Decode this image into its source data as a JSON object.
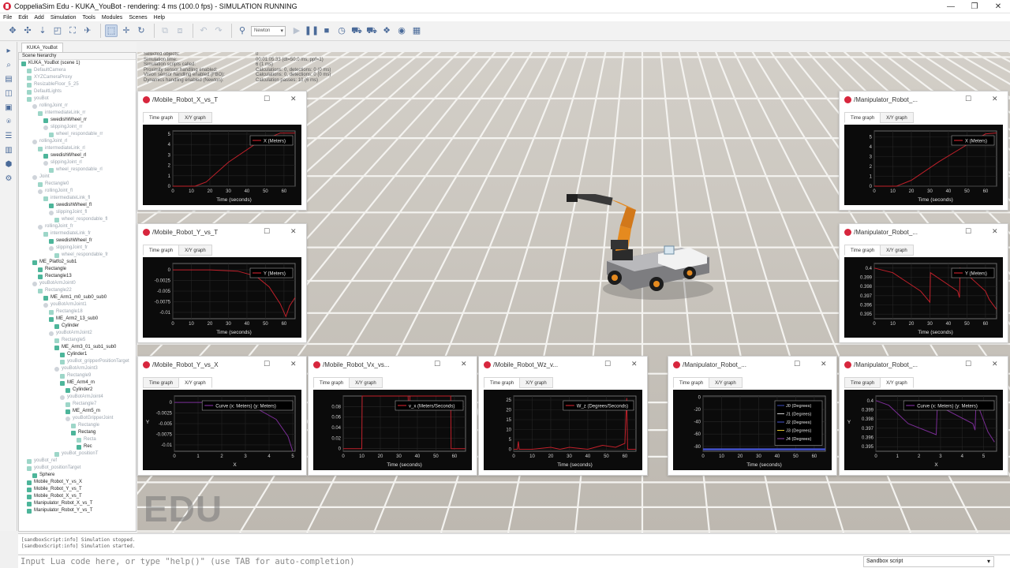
{
  "window": {
    "title": "CoppeliaSim Edu - KUKA_YouBot - rendering: 4 ms (100.0 fps) - SIMULATION RUNNING"
  },
  "menu": [
    "File",
    "Edit",
    "Add",
    "Simulation",
    "Tools",
    "Modules",
    "Scenes",
    "Help"
  ],
  "toolbar": {
    "engine": "Newton"
  },
  "scene": {
    "tab": "KUKA_YouBot",
    "header": "Scene hierarchy",
    "items": [
      {
        "label": "KUKA_YouBot (scene 1)",
        "indent": 0,
        "dim": false,
        "kind": "scene"
      },
      {
        "label": "DefaultCamera",
        "indent": 1,
        "dim": true,
        "kind": "obj"
      },
      {
        "label": "XYZCameraProxy",
        "indent": 1,
        "dim": true,
        "kind": "obj"
      },
      {
        "label": "ResizableFloor_5_25",
        "indent": 1,
        "dim": true,
        "kind": "obj"
      },
      {
        "label": "DefaultLights",
        "indent": 1,
        "dim": true,
        "kind": "obj"
      },
      {
        "label": "youBot",
        "indent": 1,
        "dim": true,
        "kind": "obj"
      },
      {
        "label": "rollingJoint_rr",
        "indent": 2,
        "dim": true,
        "kind": "joint"
      },
      {
        "label": "intermediateLink_rr",
        "indent": 3,
        "dim": true,
        "kind": "obj"
      },
      {
        "label": "swedishWheel_rr",
        "indent": 4,
        "dim": false,
        "kind": "obj"
      },
      {
        "label": "slippingJoint_rr",
        "indent": 4,
        "dim": true,
        "kind": "joint"
      },
      {
        "label": "wheel_respondable_rr",
        "indent": 5,
        "dim": true,
        "kind": "obj"
      },
      {
        "label": "rollingJoint_rl",
        "indent": 2,
        "dim": true,
        "kind": "joint"
      },
      {
        "label": "intermediateLink_rl",
        "indent": 3,
        "dim": true,
        "kind": "obj"
      },
      {
        "label": "swedishWheel_rl",
        "indent": 4,
        "dim": false,
        "kind": "obj"
      },
      {
        "label": "slippingJoint_rl",
        "indent": 4,
        "dim": true,
        "kind": "joint"
      },
      {
        "label": "wheel_respondable_rl",
        "indent": 5,
        "dim": true,
        "kind": "obj"
      },
      {
        "label": "Joint",
        "indent": 2,
        "dim": true,
        "kind": "joint"
      },
      {
        "label": "Rectangle0",
        "indent": 3,
        "dim": true,
        "kind": "obj"
      },
      {
        "label": "rollingJoint_fl",
        "indent": 3,
        "dim": true,
        "kind": "joint"
      },
      {
        "label": "intermediateLink_fl",
        "indent": 4,
        "dim": true,
        "kind": "obj"
      },
      {
        "label": "swedishWheel_fl",
        "indent": 5,
        "dim": false,
        "kind": "obj"
      },
      {
        "label": "slippingJoint_fl",
        "indent": 5,
        "dim": true,
        "kind": "joint"
      },
      {
        "label": "wheel_respondable_fl",
        "indent": 6,
        "dim": true,
        "kind": "obj"
      },
      {
        "label": "rollingJoint_fr",
        "indent": 3,
        "dim": true,
        "kind": "joint"
      },
      {
        "label": "intermediateLink_fr",
        "indent": 4,
        "dim": true,
        "kind": "obj"
      },
      {
        "label": "swedishWheel_fr",
        "indent": 5,
        "dim": false,
        "kind": "obj"
      },
      {
        "label": "slippingJoint_fr",
        "indent": 5,
        "dim": true,
        "kind": "joint"
      },
      {
        "label": "wheel_respondable_fr",
        "indent": 6,
        "dim": true,
        "kind": "obj"
      },
      {
        "label": "ME_Platfo2_sub1",
        "indent": 2,
        "dim": false,
        "kind": "obj"
      },
      {
        "label": "Rectangle",
        "indent": 3,
        "dim": false,
        "kind": "obj"
      },
      {
        "label": "Rectangle13",
        "indent": 3,
        "dim": false,
        "kind": "obj"
      },
      {
        "label": "youBotArmJoint0",
        "indent": 2,
        "dim": true,
        "kind": "joint"
      },
      {
        "label": "Rectangle22",
        "indent": 3,
        "dim": true,
        "kind": "obj"
      },
      {
        "label": "ME_Arm1_m0_sub0_sub0",
        "indent": 4,
        "dim": false,
        "kind": "obj"
      },
      {
        "label": "youBotArmJoint1",
        "indent": 4,
        "dim": true,
        "kind": "joint"
      },
      {
        "label": "Rectangle18",
        "indent": 5,
        "dim": true,
        "kind": "obj"
      },
      {
        "label": "ME_Arm2_13_sub0",
        "indent": 5,
        "dim": false,
        "kind": "obj"
      },
      {
        "label": "Cylinder",
        "indent": 6,
        "dim": false,
        "kind": "obj"
      },
      {
        "label": "youBotArmJoint2",
        "indent": 5,
        "dim": true,
        "kind": "joint"
      },
      {
        "label": "Rectangle5",
        "indent": 6,
        "dim": true,
        "kind": "obj"
      },
      {
        "label": "ME_Arm3_01_sub1_sub0",
        "indent": 6,
        "dim": false,
        "kind": "obj"
      },
      {
        "label": "Cylinder1",
        "indent": 7,
        "dim": false,
        "kind": "obj"
      },
      {
        "label": "youBot_gripperPositionTarget",
        "indent": 7,
        "dim": true,
        "kind": "obj"
      },
      {
        "label": "youBotArmJoint3",
        "indent": 6,
        "dim": true,
        "kind": "joint"
      },
      {
        "label": "Rectangle9",
        "indent": 7,
        "dim": true,
        "kind": "obj"
      },
      {
        "label": "ME_Arm4_m",
        "indent": 7,
        "dim": false,
        "kind": "obj"
      },
      {
        "label": "Cylinder2",
        "indent": 8,
        "dim": false,
        "kind": "obj"
      },
      {
        "label": "youBotArmJoint4",
        "indent": 7,
        "dim": true,
        "kind": "joint"
      },
      {
        "label": "Rectangle7",
        "indent": 8,
        "dim": true,
        "kind": "obj"
      },
      {
        "label": "ME_Arm5_m",
        "indent": 8,
        "dim": false,
        "kind": "obj"
      },
      {
        "label": "youBotGripperJoint",
        "indent": 8,
        "dim": true,
        "kind": "joint"
      },
      {
        "label": "Rectangle",
        "indent": 9,
        "dim": true,
        "kind": "obj"
      },
      {
        "label": "Rectang",
        "indent": 9,
        "dim": false,
        "kind": "obj"
      },
      {
        "label": "Recta",
        "indent": 10,
        "dim": true,
        "kind": "obj"
      },
      {
        "label": "Rec",
        "indent": 10,
        "dim": false,
        "kind": "obj"
      },
      {
        "label": "youBot_positionT",
        "indent": 6,
        "dim": true,
        "kind": "obj"
      },
      {
        "label": "youBot_ref",
        "indent": 1,
        "dim": true,
        "kind": "obj"
      },
      {
        "label": "youBot_positionTarget",
        "indent": 1,
        "dim": true,
        "kind": "obj"
      },
      {
        "label": "Sphere",
        "indent": 2,
        "dim": false,
        "kind": "obj"
      },
      {
        "label": "Mobile_Robot_Y_vs_X",
        "indent": 1,
        "dim": false,
        "kind": "graph"
      },
      {
        "label": "Mobile_Robot_Y_vs_T",
        "indent": 1,
        "dim": false,
        "kind": "graph"
      },
      {
        "label": "Mobile_Robot_X_vs_T",
        "indent": 1,
        "dim": false,
        "kind": "graph"
      },
      {
        "label": "Manipulator_Robot_X_vs_T",
        "indent": 1,
        "dim": false,
        "kind": "graph"
      },
      {
        "label": "Manipulator_Robot_Y_vs_T",
        "indent": 1,
        "dim": false,
        "kind": "graph"
      }
    ]
  },
  "sim_info": [
    {
      "k": "Selected objects:",
      "v": "0"
    },
    {
      "k": "Simulation time:",
      "v": "00:01:05.33 (dt=50.0 ms, ppf=1)"
    },
    {
      "k": "Simulation scripts called:",
      "v": "6 (1 ms)"
    },
    {
      "k": "Proximity sensor handling enabled:",
      "v": "Calculations: 0, detections: 0 (0 ms)"
    },
    {
      "k": "Vision sensor handling enabled (FBO):",
      "v": "Calculations: 0, detections: 0 (0 ms)"
    },
    {
      "k": "Dynamics handling enabled (Newton):",
      "v": "Calculation passes: 10 (6 ms)"
    }
  ],
  "watermark": "EDU",
  "graphs": {
    "w1": {
      "title": "/Mobile_Robot_X_vs_T",
      "tab1": "Time graph",
      "tab2": "X/Y graph",
      "active": 1,
      "legend": "X (Meters)",
      "xlabel": "Time (seconds)",
      "ylabel": "",
      "xticks": [
        "0",
        "10",
        "20",
        "30",
        "40",
        "50",
        "60"
      ],
      "yticks": [
        "0",
        "1",
        "2",
        "3",
        "4",
        "5"
      ]
    },
    "w2": {
      "title": "/Mobile_Robot_Y_vs_T",
      "tab1": "Time graph",
      "tab2": "X/Y graph",
      "active": 1,
      "legend": "Y (Meters)",
      "xlabel": "Time (seconds)",
      "ylabel": "",
      "xticks": [
        "0",
        "10",
        "20",
        "30",
        "40",
        "50",
        "60"
      ],
      "yticks": [
        "0",
        "-0.0025",
        "-0.005",
        "-0.0075",
        "-0.01"
      ]
    },
    "w3": {
      "title": "/Mobile_Robot_Y_vs_X",
      "tab1": "Time graph",
      "tab2": "X/Y graph",
      "active": 2,
      "legend": "Curve (x: Meters) (y: Meters)",
      "xlabel": "X",
      "ylabel": "Y",
      "xticks": [
        "0",
        "1",
        "2",
        "3",
        "4",
        "5"
      ],
      "yticks": [
        "0",
        "-0.0025",
        "-0.005",
        "-0.0075",
        "-0.01"
      ]
    },
    "w4": {
      "title": "/Mobile_Robot_Vx_vs...",
      "tab1": "Time graph",
      "tab2": "X/Y graph",
      "active": 1,
      "legend": "v_x (Meters/Seconds)",
      "xlabel": "Time (seconds)",
      "ylabel": "",
      "xticks": [
        "0",
        "10",
        "20",
        "30",
        "40",
        "50",
        "60"
      ],
      "yticks": [
        "0",
        "0.02",
        "0.04",
        "0.06",
        "0.08"
      ]
    },
    "w5": {
      "title": "/Mobile_Robot_Wz_v...",
      "tab1": "Time graph",
      "tab2": "X/Y graph",
      "active": 1,
      "legend": "W_z (Degrees/Seconds)",
      "xlabel": "Time (seconds)",
      "ylabel": "",
      "xticks": [
        "0",
        "10",
        "20",
        "30",
        "40",
        "50",
        "60"
      ],
      "yticks": [
        "0",
        "5",
        "10",
        "15",
        "20",
        "25"
      ]
    },
    "w6": {
      "title": "/Manipulator_Robot_...",
      "tab1": "Time graph",
      "tab2": "X/Y graph",
      "active": 1,
      "legend": "X (Meters)",
      "xlabel": "Time (seconds)",
      "ylabel": "",
      "xticks": [
        "0",
        "10",
        "20",
        "30",
        "40",
        "50",
        "60"
      ],
      "yticks": [
        "0",
        "1",
        "2",
        "3",
        "4",
        "5"
      ]
    },
    "w7": {
      "title": "/Manipulator_Robot_...",
      "tab1": "Time graph",
      "tab2": "X/Y graph",
      "active": 1,
      "legend": "Y (Meters)",
      "xlabel": "Time (seconds)",
      "ylabel": "",
      "xticks": [
        "0",
        "10",
        "20",
        "30",
        "40",
        "50",
        "60"
      ],
      "yticks": [
        "0.4",
        "0.399",
        "0.398",
        "0.397",
        "0.396",
        "0.395"
      ]
    },
    "w8": {
      "title": "/Manipulator_Robot_...",
      "tab1": "Time graph",
      "tab2": "X/Y graph",
      "active": 1,
      "legends": [
        "J0 (Degrees)",
        "J1 (Degrees)",
        "J2 (Degrees)",
        "J3 (Degrees)",
        "J4 (Degrees)"
      ],
      "xlabel": "Time (seconds)",
      "ylabel": "",
      "xticks": [
        "0",
        "10",
        "20",
        "30",
        "40",
        "50",
        "60"
      ],
      "yticks": [
        "0",
        "-20",
        "-40",
        "-60",
        "-80"
      ]
    },
    "w9": {
      "title": "/Manipulator_Robot_...",
      "tab1": "Time graph",
      "tab2": "X/Y graph",
      "active": 2,
      "legend": "Curve (x: Meters) (y: Meters)",
      "xlabel": "X",
      "ylabel": "Y",
      "xticks": [
        "0",
        "1",
        "2",
        "3",
        "4",
        "5"
      ],
      "yticks": [
        "0.4",
        "0.399",
        "0.398",
        "0.397",
        "0.396",
        "0.395"
      ]
    }
  },
  "chart_data": [
    {
      "type": "line",
      "id": "w1",
      "xlim": [
        0,
        66
      ],
      "ylim": [
        0,
        5.3
      ],
      "color": "#c0202a",
      "series": [
        {
          "name": "X (Meters)",
          "x": [
            0,
            12,
            18,
            30,
            45,
            58,
            66
          ],
          "y": [
            0,
            0,
            0.4,
            2.3,
            4.1,
            5.1,
            5.1
          ]
        }
      ]
    },
    {
      "type": "line",
      "id": "w2",
      "xlim": [
        0,
        66
      ],
      "ylim": [
        -0.0115,
        0.0015
      ],
      "color": "#c0202a",
      "series": [
        {
          "name": "Y (Meters)",
          "x": [
            0,
            10,
            20,
            35,
            45,
            52,
            58,
            61,
            63,
            66
          ],
          "y": [
            0,
            0,
            0,
            -0.0003,
            -0.0015,
            -0.004,
            -0.008,
            -0.011,
            -0.0085,
            -0.0065
          ]
        }
      ]
    },
    {
      "type": "line",
      "id": "w3",
      "xlim": [
        0,
        5.1
      ],
      "ylim": [
        -0.0115,
        0.0015
      ],
      "color": "#7a2d96",
      "series": [
        {
          "name": "Curve (x: Meters) (y: Meters)",
          "x": [
            0,
            0.6,
            1.5,
            2.5,
            3.5,
            4.3,
            4.8,
            5.0
          ],
          "y": [
            0,
            0,
            0,
            -0.0003,
            -0.0015,
            -0.004,
            -0.008,
            -0.0115
          ]
        }
      ]
    },
    {
      "type": "line",
      "id": "w4",
      "xlim": [
        0,
        66
      ],
      "ylim": [
        -0.005,
        0.1
      ],
      "color": "#c0202a",
      "series": [
        {
          "name": "v_x (Meters/Seconds)",
          "x": [
            0,
            10,
            10.2,
            35,
            35.2,
            35.8,
            36,
            58,
            58.2,
            66
          ],
          "y": [
            0,
            0,
            0.1,
            0.1,
            0.08,
            0.08,
            0.1,
            0.1,
            0,
            0
          ]
        }
      ]
    },
    {
      "type": "line",
      "id": "w5",
      "xlim": [
        0,
        66
      ],
      "ylim": [
        -1,
        27
      ],
      "color": "#c0202a",
      "series": [
        {
          "name": "W_z (Degrees/Seconds)",
          "x": [
            0,
            2,
            2.5,
            3,
            10,
            20,
            25,
            30,
            40,
            48,
            55,
            60,
            61,
            61.5,
            66
          ],
          "y": [
            0,
            0,
            4,
            0,
            0,
            1,
            0,
            1,
            0,
            2,
            1,
            3,
            26,
            0,
            0
          ]
        }
      ]
    },
    {
      "type": "line",
      "id": "w6",
      "xlim": [
        0,
        66
      ],
      "ylim": [
        0,
        5.6
      ],
      "color": "#c0202a",
      "series": [
        {
          "name": "X (Meters)",
          "x": [
            0,
            12,
            20,
            35,
            50,
            60,
            66
          ],
          "y": [
            0,
            0,
            0.6,
            2.5,
            4.2,
            5.3,
            5.4
          ]
        }
      ]
    },
    {
      "type": "line",
      "id": "w7",
      "xlim": [
        0,
        66
      ],
      "ylim": [
        0.3945,
        0.4005
      ],
      "color": "#c0202a",
      "series": [
        {
          "name": "Y (Meters)",
          "x": [
            0,
            10,
            25,
            30,
            30.3,
            45,
            46,
            46.3,
            60,
            62,
            66
          ],
          "y": [
            0.4,
            0.3995,
            0.3975,
            0.3963,
            0.3995,
            0.3975,
            0.3968,
            0.4,
            0.3975,
            0.3966,
            0.3955
          ]
        }
      ]
    },
    {
      "type": "line",
      "id": "w8",
      "xlim": [
        0,
        66
      ],
      "ylim": [
        -88,
        2
      ],
      "color": "#3b4cc0",
      "series": [
        {
          "name": "J0 (Degrees)",
          "x": [
            0,
            66
          ],
          "y": [
            -85,
            -85
          ]
        },
        {
          "name": "J1 (Degrees)",
          "x": [
            0,
            66
          ],
          "y": [
            -84,
            -84
          ]
        },
        {
          "name": "J2 (Degrees)",
          "x": [
            0,
            66
          ],
          "y": [
            -86,
            -86
          ]
        },
        {
          "name": "J3 (Degrees)",
          "x": [
            0,
            66
          ],
          "y": [
            -85.5,
            -85.5
          ]
        },
        {
          "name": "J4 (Degrees)",
          "x": [
            0,
            66
          ],
          "y": [
            -84.5,
            -84.5
          ]
        }
      ]
    },
    {
      "type": "line",
      "id": "w9",
      "xlim": [
        0,
        5.6
      ],
      "ylim": [
        0.3945,
        0.4005
      ],
      "color": "#7a2d96",
      "series": [
        {
          "name": "Curve (x: Meters) (y: Meters)",
          "x": [
            0,
            0.6,
            1.5,
            2.8,
            2.85,
            4.5,
            4.6,
            4.65,
            5.2,
            5.5
          ],
          "y": [
            0.4,
            0.3995,
            0.3975,
            0.3963,
            0.3995,
            0.3975,
            0.3968,
            0.4,
            0.3966,
            0.3955
          ]
        }
      ]
    }
  ],
  "console": {
    "lines": [
      "[sandboxScript:info] Simulation stopped.",
      "[sandboxScript:info] Simulation started."
    ],
    "placeholder": "Input Lua code here, or type \"help()\" (use TAB for auto-completion)",
    "script_select": "Sandbox script"
  }
}
